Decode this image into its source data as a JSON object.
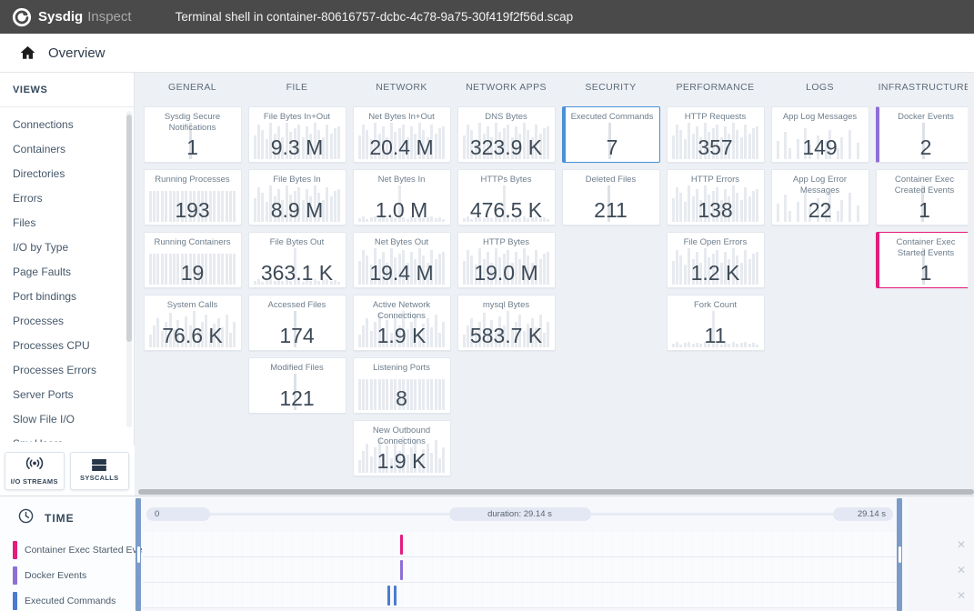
{
  "topbar": {
    "brand": "Sysdig",
    "brand_suffix": "Inspect",
    "capture_title": "Terminal shell in container-80616757-dcbc-4c78-9a75-30f419f2f56d.scap"
  },
  "nav": {
    "overview": "Overview"
  },
  "sidebar": {
    "header": "VIEWS",
    "items": [
      "Connections",
      "Containers",
      "Directories",
      "Errors",
      "Files",
      "I/O by Type",
      "Page Faults",
      "Port bindings",
      "Processes",
      "Processes CPU",
      "Processes Errors",
      "Server Ports",
      "Slow File I/O",
      "Spy Users"
    ],
    "buttons": [
      {
        "label": "I/O STREAMS",
        "icon": "broadcast-icon"
      },
      {
        "label": "SYSCALLS",
        "icon": "list-icon"
      }
    ]
  },
  "overview": {
    "columns": [
      {
        "label": "GENERAL",
        "tiles": [
          {
            "title": "Sysdig Secure Notifications",
            "value": "1",
            "spark": "spike"
          },
          {
            "title": "Running Processes",
            "value": "193",
            "spark": "full"
          },
          {
            "title": "Running Containers",
            "value": "19",
            "spark": "full"
          },
          {
            "title": "System Calls",
            "value": "76.6 K",
            "spark": "varied"
          }
        ]
      },
      {
        "label": "FILE",
        "tiles": [
          {
            "title": "File Bytes In+Out",
            "value": "9.3 M",
            "spark": "tall"
          },
          {
            "title": "File Bytes In",
            "value": "8.9 M",
            "spark": "tall"
          },
          {
            "title": "File Bytes Out",
            "value": "363.1 K",
            "spark": "lowspike"
          },
          {
            "title": "Accessed Files",
            "value": "174",
            "spark": "spike"
          },
          {
            "title": "Modified Files",
            "value": "121",
            "spark": "spike"
          }
        ]
      },
      {
        "label": "NETWORK",
        "tiles": [
          {
            "title": "Net Bytes In+Out",
            "value": "20.4 M",
            "spark": "tall"
          },
          {
            "title": "Net Bytes In",
            "value": "1.0 M",
            "spark": "lowspike"
          },
          {
            "title": "Net Bytes Out",
            "value": "19.4 M",
            "spark": "tall"
          },
          {
            "title": "Active Network Connections",
            "value": "1.9 K",
            "spark": "varied"
          },
          {
            "title": "Listening Ports",
            "value": "8",
            "spark": "full"
          },
          {
            "title": "New Outbound Connections",
            "value": "1.9 K",
            "spark": "varied"
          }
        ]
      },
      {
        "label": "NETWORK APPS",
        "tiles": [
          {
            "title": "DNS Bytes",
            "value": "323.9 K",
            "spark": "tall"
          },
          {
            "title": "HTTPs Bytes",
            "value": "476.5 K",
            "spark": "lowspike"
          },
          {
            "title": "HTTP Bytes",
            "value": "19.0 M",
            "spark": "tall"
          },
          {
            "title": "mysql Bytes",
            "value": "583.7 K",
            "spark": "varied"
          }
        ]
      },
      {
        "label": "SECURITY",
        "tiles": [
          {
            "title": "Executed Commands",
            "value": "7",
            "spark": "spike",
            "accent": "#4a90d9",
            "accent_style": "selected"
          },
          {
            "title": "Deleted Files",
            "value": "211",
            "spark": "spike"
          }
        ]
      },
      {
        "label": "PERFORMANCE",
        "tiles": [
          {
            "title": "HTTP Requests",
            "value": "357",
            "spark": "tall"
          },
          {
            "title": "HTTP Errors",
            "value": "138",
            "spark": "tall"
          },
          {
            "title": "File Open Errors",
            "value": "1.2 K",
            "spark": "tall"
          },
          {
            "title": "Fork Count",
            "value": "11",
            "spark": "lowspike"
          }
        ]
      },
      {
        "label": "LOGS",
        "tiles": [
          {
            "title": "App Log Messages",
            "value": "149",
            "spark": "sparse"
          },
          {
            "title": "App Log Error Messages",
            "value": "22",
            "spark": "sparse"
          }
        ]
      },
      {
        "label": "INFRASTRUCTURE",
        "tiles": [
          {
            "title": "Docker Events",
            "value": "2",
            "spark": "spike",
            "accent": "#8e6fd6",
            "accent_style": "left"
          },
          {
            "title": "Container Exec Created Events",
            "value": "1",
            "spark": "spike"
          },
          {
            "title": "Container Exec Started Events",
            "value": "1",
            "spark": "spike",
            "accent": "#e31c7e",
            "accent_style": "selected"
          }
        ]
      }
    ]
  },
  "timeline": {
    "header": "TIME",
    "ruler": {
      "start": "0",
      "duration": "duration: 29.14 s",
      "end": "29.14 s"
    },
    "close_icon": "✕",
    "rows": [
      {
        "label": "Container Exec Started Events",
        "color": "#e31c7e",
        "marks_pct": [
          34.3
        ]
      },
      {
        "label": "Docker Events",
        "color": "#8e6fd6",
        "marks_pct": [
          34.3
        ]
      },
      {
        "label": "Executed Commands",
        "color": "#4a7bd0",
        "marks_pct": [
          32.6,
          33.4
        ]
      }
    ]
  }
}
